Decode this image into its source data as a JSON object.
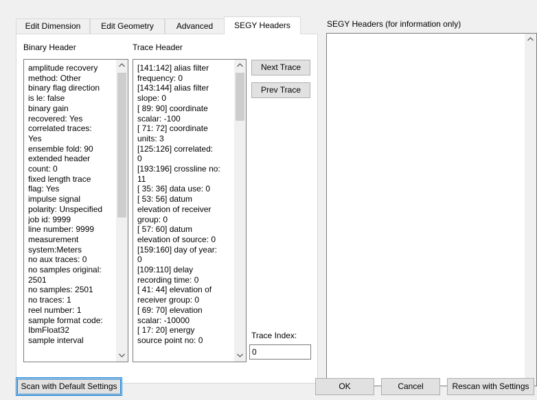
{
  "tabs": [
    {
      "label": "Edit Dimension"
    },
    {
      "label": "Edit Geometry"
    },
    {
      "label": "Advanced"
    },
    {
      "label": "SEGY Headers"
    }
  ],
  "active_tab": "SEGY Headers",
  "binary_header": {
    "label": "Binary Header",
    "lines": [
      "amplitude recovery",
      "method: Other",
      "binary flag direction",
      "is le: false",
      "binary gain",
      "recovered: Yes",
      "correlated traces:",
      "Yes",
      "ensemble fold: 90",
      "extended header",
      "count: 0",
      "fixed length trace",
      "flag: Yes",
      "impulse signal",
      "polarity: Unspecified",
      "job id: 9999",
      "line number: 9999",
      "measurement",
      "system:Meters",
      "no aux traces: 0",
      "no samples original:",
      "2501",
      "no samples: 2501",
      "no traces: 1",
      "reel number: 1",
      "sample format code:",
      "IbmFloat32",
      "sample interval"
    ]
  },
  "trace_header": {
    "label": "Trace Header",
    "lines": [
      "[141:142] alias filter",
      "frequency: 0",
      "[143:144] alias filter",
      "slope: 0",
      "[ 89: 90] coordinate",
      "scalar: -100",
      "[ 71: 72] coordinate",
      "units: 3",
      "[125:126] correlated:",
      "0",
      "[193:196] crossline no:",
      "11",
      "[ 35: 36] data use: 0",
      "[ 53: 56] datum",
      "elevation of receiver",
      "group: 0",
      "[ 57: 60] datum",
      "elevation of source: 0",
      "[159:160] day of year:",
      "0",
      "[109:110] delay",
      "recording time: 0",
      "[ 41: 44] elevation of",
      "receiver group: 0",
      "[ 69: 70] elevation",
      "scalar: -10000",
      "[ 17: 20] energy",
      "source point no: 0"
    ]
  },
  "buttons": {
    "next_trace": "Next Trace",
    "prev_trace": "Prev Trace",
    "scan_default": "Scan with Default Settings",
    "ok": "OK",
    "cancel": "Cancel",
    "rescan": "Rescan with Settings"
  },
  "trace_index": {
    "label": "Trace Index:",
    "value": "0"
  },
  "segy_info": {
    "label": "SEGY Headers (for information only)",
    "text": ""
  },
  "icons": {
    "scroll_up": "chevron-up-icon",
    "scroll_down": "chevron-down-icon"
  },
  "colors": {
    "window_bg": "#f0f0f0",
    "panel_bg": "#ffffff",
    "button_bg": "#e1e1e1",
    "focus_border": "#0078d7",
    "scroll_thumb": "#cdcdcd"
  }
}
